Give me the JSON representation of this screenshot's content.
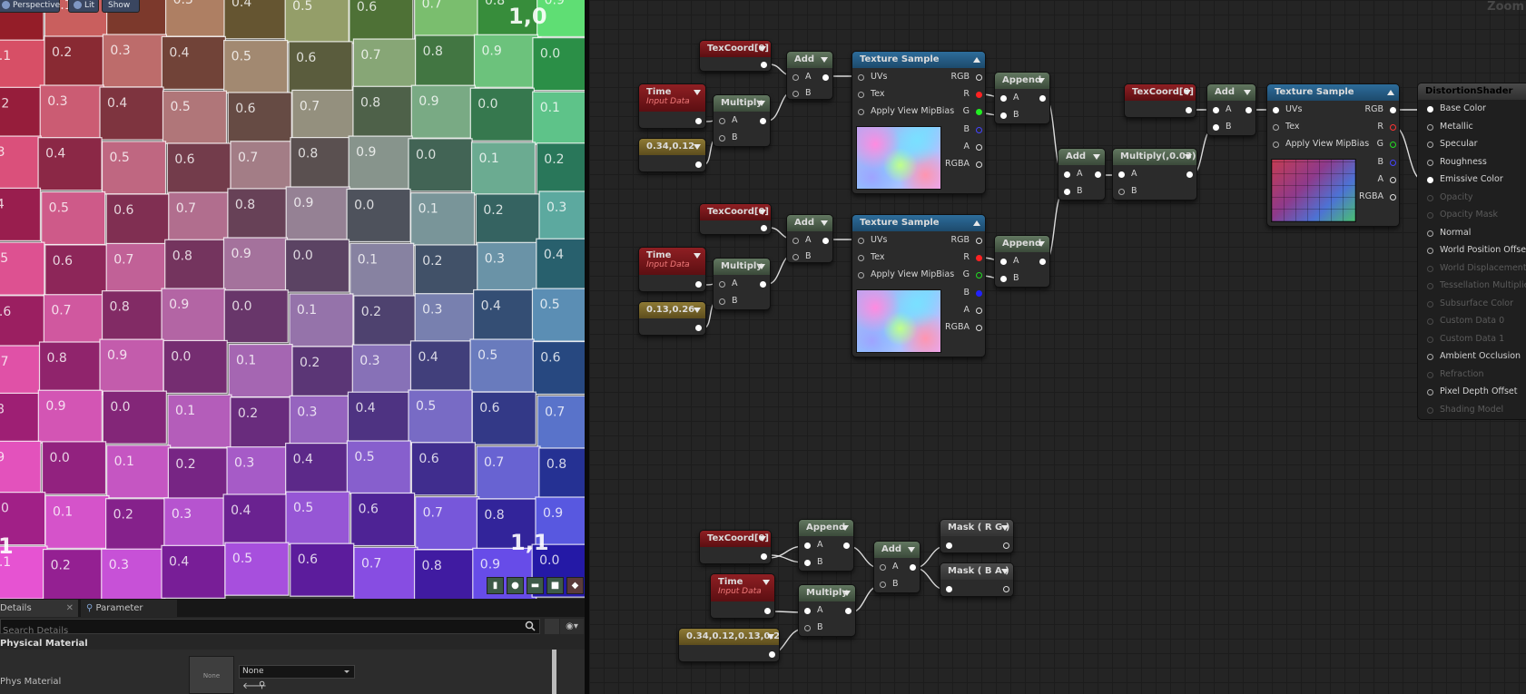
{
  "viewport": {
    "toolbar": [
      "Perspective",
      "Lit",
      "Show"
    ],
    "top_label": "1,0",
    "corner_label": "1,1",
    "left_label": "1",
    "bottom_buttons": [
      "btn1",
      "btn2",
      "btn3",
      "btn4",
      "btn5"
    ]
  },
  "details": {
    "tabs": [
      "Details",
      "Parameter Defaults"
    ],
    "search_placeholder": "Search Details",
    "category": "Physical Material",
    "property_label": "Phys Material",
    "thumb_label": "None",
    "select_value": "None"
  },
  "graph": {
    "zoom_label": "Zoom",
    "nodes": {
      "texcoord_a": "TexCoord[0]",
      "time_a": "Time",
      "time_a_sub": "Input Data",
      "const_a": "0.34,0.12",
      "multiply_a": "Multiply",
      "add_a": "Add",
      "texsample_a": "Texture Sample",
      "append_a": "Append",
      "texcoord_b": "TexCoord[0]",
      "time_b": "Time",
      "time_b_sub": "Input Data",
      "const_b": "0.13,0.26",
      "multiply_b": "Multiply",
      "add_b": "Add",
      "texsample_b": "Texture Sample",
      "append_b": "Append",
      "add_c": "Add",
      "multiply_c": "Multiply(,0.03)",
      "texcoord_c": "TexCoord[0]",
      "add_d": "Add",
      "texsample_c": "Texture Sample",
      "texcoord_d": "TexCoord[0]",
      "time_d": "Time",
      "time_d_sub": "Input Data",
      "const_d": "0.34,0.12,0.13,0.26",
      "append_d": "Append",
      "multiply_d": "Multiply",
      "add_e": "Add",
      "mask_rg": "Mask ( R G )",
      "mask_ba": "Mask ( B A )"
    },
    "pins": {
      "a": "A",
      "b": "B",
      "uvs": "UVs",
      "tex": "Tex",
      "mip": "Apply View MipBias",
      "rgb": "RGB",
      "r": "R",
      "g": "G",
      "bb": "B",
      "aa": "A",
      "rgba": "RGBA"
    },
    "material": {
      "title": "DistortionShader",
      "inputs": [
        "Base Color",
        "Metallic",
        "Specular",
        "Roughness",
        "Emissive Color",
        "Opacity",
        "Opacity Mask",
        "Normal",
        "World Position Offset",
        "World Displacement",
        "Tessellation Multiplier",
        "Subsurface Color",
        "Custom Data 0",
        "Custom Data 1",
        "Ambient Occlusion",
        "Refraction",
        "Pixel Depth Offset",
        "Shading Model"
      ],
      "enabled": [
        true,
        true,
        true,
        true,
        true,
        false,
        false,
        true,
        true,
        false,
        false,
        false,
        false,
        false,
        true,
        false,
        true,
        false
      ]
    }
  }
}
